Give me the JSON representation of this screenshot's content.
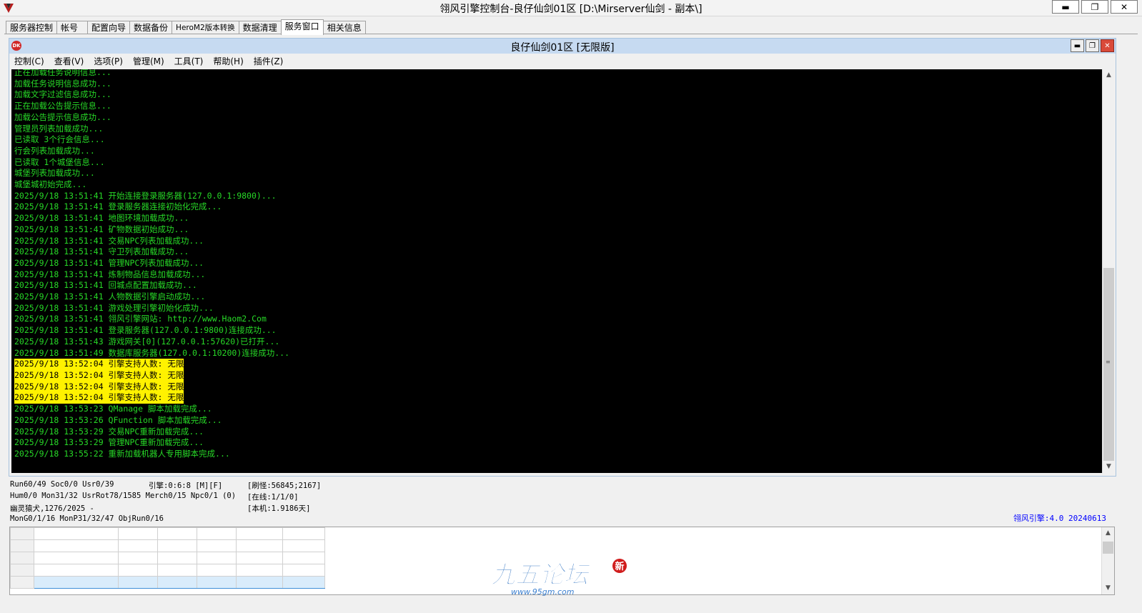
{
  "window": {
    "title": "翎风引擎控制台-良仔仙剑01区 [D:\\Mirserver仙剑 - 副本\\]"
  },
  "tabs": [
    "服务器控制",
    "帐号",
    "配置向导",
    "数据备份",
    "HeroM2版本转换",
    "数据清理",
    "服务窗口",
    "相关信息"
  ],
  "active_tab": "服务窗口",
  "inner_window": {
    "title": "良仔仙剑01区 [无限版]",
    "menu": [
      "控制(C)",
      "查看(V)",
      "选项(P)",
      "管理(M)",
      "工具(T)",
      "帮助(H)",
      "插件(Z)"
    ]
  },
  "log_lines": [
    {
      "text": "正在加载任务说明信息...",
      "highlight": false
    },
    {
      "text": "加载任务说明信息成功...",
      "highlight": false
    },
    {
      "text": "加载文字过滤信息成功...",
      "highlight": false
    },
    {
      "text": "正在加载公告提示信息...",
      "highlight": false
    },
    {
      "text": "加载公告提示信息成功...",
      "highlight": false
    },
    {
      "text": "管理员列表加载成功...",
      "highlight": false
    },
    {
      "text": "已读取 3个行会信息...",
      "highlight": false
    },
    {
      "text": "行会列表加载成功...",
      "highlight": false
    },
    {
      "text": "已读取 1个城堡信息...",
      "highlight": false
    },
    {
      "text": "城堡列表加载成功...",
      "highlight": false
    },
    {
      "text": "城堡城初始完成...",
      "highlight": false
    },
    {
      "text": "2025/9/18 13:51:41 开始连接登录服务器(127.0.0.1:9800)...",
      "highlight": false
    },
    {
      "text": "2025/9/18 13:51:41 登录服务器连接初始化完成...",
      "highlight": false
    },
    {
      "text": "2025/9/18 13:51:41 地图环境加载成功...",
      "highlight": false
    },
    {
      "text": "2025/9/18 13:51:41 矿物数据初始成功...",
      "highlight": false
    },
    {
      "text": "2025/9/18 13:51:41 交易NPC列表加载成功...",
      "highlight": false
    },
    {
      "text": "2025/9/18 13:51:41 守卫列表加载成功...",
      "highlight": false
    },
    {
      "text": "2025/9/18 13:51:41 管理NPC列表加载成功...",
      "highlight": false
    },
    {
      "text": "2025/9/18 13:51:41 炼制物品信息加载成功...",
      "highlight": false
    },
    {
      "text": "2025/9/18 13:51:41 回城点配置加载成功...",
      "highlight": false
    },
    {
      "text": "2025/9/18 13:51:41 人物数据引擎启动成功...",
      "highlight": false
    },
    {
      "text": "2025/9/18 13:51:41 游戏处理引擎初始化成功...",
      "highlight": false
    },
    {
      "text": "2025/9/18 13:51:41 翎风引擎网站: http://www.Haom2.Com",
      "highlight": false
    },
    {
      "text": "2025/9/18 13:51:41 登录服务器(127.0.0.1:9800)连接成功...",
      "highlight": false
    },
    {
      "text": "2025/9/18 13:51:43 游戏网关[0](127.0.0.1:57620)已打开...",
      "highlight": false
    },
    {
      "text": "2025/9/18 13:51:49 数据库服务器(127.0.0.1:10200)连接成功...",
      "highlight": false
    },
    {
      "text": "2025/9/18 13:52:04 引擎支持人数: 无限",
      "highlight": true
    },
    {
      "text": "2025/9/18 13:52:04 引擎支持人数: 无限",
      "highlight": true
    },
    {
      "text": "2025/9/18 13:52:04 引擎支持人数: 无限",
      "highlight": true
    },
    {
      "text": "2025/9/18 13:52:04 引擎支持人数: 无限",
      "highlight": true
    },
    {
      "text": "2025/9/18 13:53:23 QManage 脚本加载完成...",
      "highlight": false
    },
    {
      "text": "2025/9/18 13:53:26 QFunction 脚本加载完成...",
      "highlight": false
    },
    {
      "text": "2025/9/18 13:53:29 交易NPC重新加载完成...",
      "highlight": false
    },
    {
      "text": "2025/9/18 13:53:29 管理NPC重新加载完成...",
      "highlight": false
    },
    {
      "text": "2025/9/18 13:55:22 重新加载机器人专用脚本完成...",
      "highlight": false
    }
  ],
  "status": {
    "line1_left": "Run60/49 Soc0/0 Usr0/39",
    "line1_mid": "引擎:0:6:8 [M][F]",
    "line1_right": "[刷怪:56845;2167]",
    "line2_left": "Hum0/0 Mon31/32 UsrRot78/1585 Merch0/15 Npc0/1 (0)",
    "line2_right": "[在线:1/1/0]",
    "line3_left": "幽灵猿犬,1276/2025 -",
    "line3_right": "[本机:1.9186天]",
    "line4_left": "MonG0/1/16 MonP31/32/47 ObjRun0/16",
    "version": "翎风引擎:4.0 20240613"
  },
  "watermark": {
    "text": "九五论坛",
    "badge": "新",
    "url": "www.95gm.com"
  },
  "colors": {
    "console_bg": "#000000",
    "console_text": "#27d827",
    "highlight_bg": "#fff200",
    "version_text": "#0000ff",
    "inner_title_bg": "#c6daf1"
  }
}
